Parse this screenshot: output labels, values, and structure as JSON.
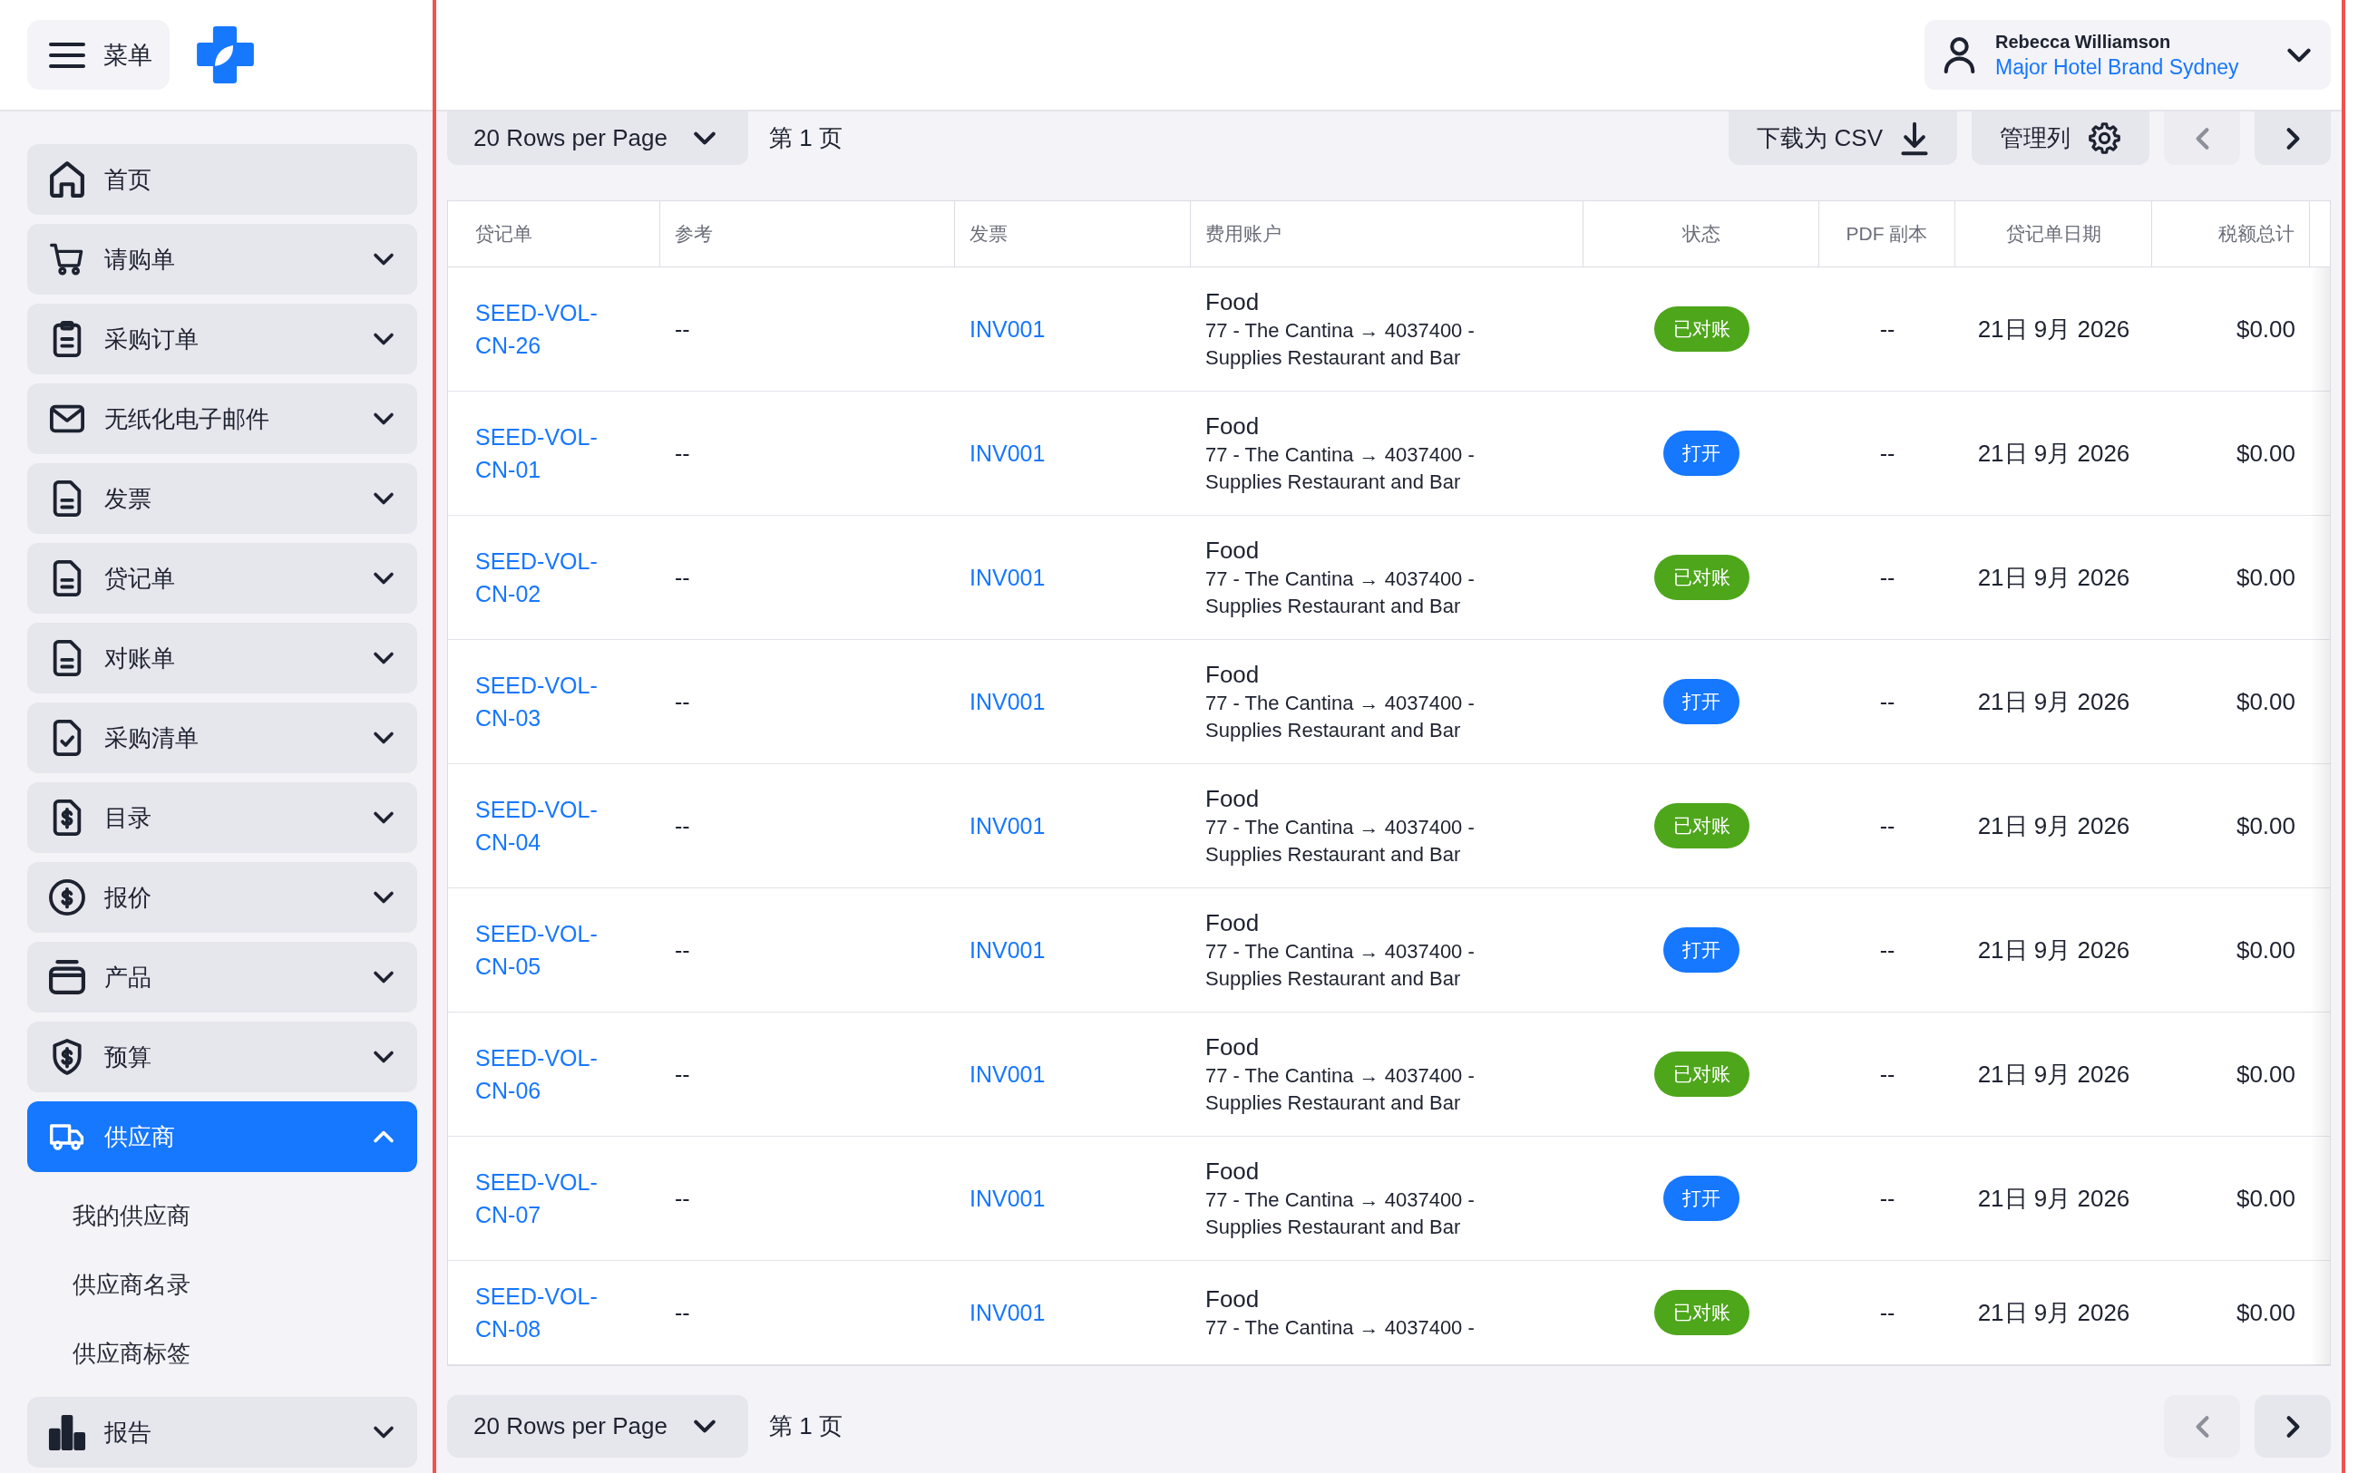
{
  "sidebar": {
    "menu_button": "菜单",
    "items": [
      {
        "label": "首页",
        "kind": "link",
        "selected": false,
        "expanded": false
      },
      {
        "label": "请购单",
        "kind": "group",
        "selected": false,
        "expanded": false
      },
      {
        "label": "采购订单",
        "kind": "group",
        "selected": false,
        "expanded": false
      },
      {
        "label": "无纸化电子邮件",
        "kind": "group",
        "selected": false,
        "expanded": false
      },
      {
        "label": "发票",
        "kind": "group",
        "selected": false,
        "expanded": false
      },
      {
        "label": "贷记单",
        "kind": "group",
        "selected": false,
        "expanded": false
      },
      {
        "label": "对账单",
        "kind": "group",
        "selected": false,
        "expanded": false
      },
      {
        "label": "采购清单",
        "kind": "group",
        "selected": false,
        "expanded": false
      },
      {
        "label": "目录",
        "kind": "group",
        "selected": false,
        "expanded": false
      },
      {
        "label": "报价",
        "kind": "group",
        "selected": false,
        "expanded": false
      },
      {
        "label": "产品",
        "kind": "group",
        "selected": false,
        "expanded": false
      },
      {
        "label": "预算",
        "kind": "group",
        "selected": false,
        "expanded": false
      },
      {
        "label": "供应商",
        "kind": "group",
        "selected": true,
        "expanded": true,
        "children": [
          {
            "label": "我的供应商",
            "selected": false
          },
          {
            "label": "供应商名录",
            "selected": false
          },
          {
            "label": "供应商标签",
            "selected": false
          }
        ]
      },
      {
        "label": "报告",
        "kind": "group",
        "selected": false,
        "expanded": false
      }
    ]
  },
  "user_menu": {
    "name": "Rebecca Williamson",
    "organization": "Major Hotel Brand Sydney"
  },
  "toolbar": {
    "rows_per_page": "20 Rows per Page",
    "page": "第 1 页",
    "download_button": "下载为 CSV",
    "columns_button": "管理列",
    "previous": {
      "disabled": true
    },
    "next": {
      "disabled": false
    }
  },
  "table": {
    "columns": [
      "贷记单",
      "参考",
      "发票",
      "费用账户",
      "状态",
      "PDF 副本",
      "贷记单日期",
      "税额总计"
    ],
    "rows": [
      {
        "credit_note": "SEED-VOL-CN-26",
        "reference": "--",
        "invoice": "INV001",
        "account": {
          "name": "Food",
          "path": "77 - The Cantina → 4037400 - Supplies Restaurant and Bar"
        },
        "status": {
          "label": "已对账",
          "color": "#4ea61b"
        },
        "pdf_copy": "--",
        "date": "21日 9月 2026",
        "tax_total": "$0.00"
      },
      {
        "credit_note": "SEED-VOL-CN-01",
        "reference": "--",
        "invoice": "INV001",
        "account": {
          "name": "Food",
          "path": "77 - The Cantina → 4037400 - Supplies Restaurant and Bar"
        },
        "status": {
          "label": "打开",
          "color": "#1677ff"
        },
        "pdf_copy": "--",
        "date": "21日 9月 2026",
        "tax_total": "$0.00"
      },
      {
        "credit_note": "SEED-VOL-CN-02",
        "reference": "--",
        "invoice": "INV001",
        "account": {
          "name": "Food",
          "path": "77 - The Cantina → 4037400 - Supplies Restaurant and Bar"
        },
        "status": {
          "label": "已对账",
          "color": "#4ea61b"
        },
        "pdf_copy": "--",
        "date": "21日 9月 2026",
        "tax_total": "$0.00"
      },
      {
        "credit_note": "SEED-VOL-CN-03",
        "reference": "--",
        "invoice": "INV001",
        "account": {
          "name": "Food",
          "path": "77 - The Cantina → 4037400 - Supplies Restaurant and Bar"
        },
        "status": {
          "label": "打开",
          "color": "#1677ff"
        },
        "pdf_copy": "--",
        "date": "21日 9月 2026",
        "tax_total": "$0.00"
      },
      {
        "credit_note": "SEED-VOL-CN-04",
        "reference": "--",
        "invoice": "INV001",
        "account": {
          "name": "Food",
          "path": "77 - The Cantina → 4037400 - Supplies Restaurant and Bar"
        },
        "status": {
          "label": "已对账",
          "color": "#4ea61b"
        },
        "pdf_copy": "--",
        "date": "21日 9月 2026",
        "tax_total": "$0.00"
      },
      {
        "credit_note": "SEED-VOL-CN-05",
        "reference": "--",
        "invoice": "INV001",
        "account": {
          "name": "Food",
          "path": "77 - The Cantina → 4037400 - Supplies Restaurant and Bar"
        },
        "status": {
          "label": "打开",
          "color": "#1677ff"
        },
        "pdf_copy": "--",
        "date": "21日 9月 2026",
        "tax_total": "$0.00"
      },
      {
        "credit_note": "SEED-VOL-CN-06",
        "reference": "--",
        "invoice": "INV001",
        "account": {
          "name": "Food",
          "path": "77 - The Cantina → 4037400 - Supplies Restaurant and Bar"
        },
        "status": {
          "label": "已对账",
          "color": "#4ea61b"
        },
        "pdf_copy": "--",
        "date": "21日 9月 2026",
        "tax_total": "$0.00"
      },
      {
        "credit_note": "SEED-VOL-CN-07",
        "reference": "--",
        "invoice": "INV001",
        "account": {
          "name": "Food",
          "path": "77 - The Cantina → 4037400 - Supplies Restaurant and Bar"
        },
        "status": {
          "label": "打开",
          "color": "#1677ff"
        },
        "pdf_copy": "--",
        "date": "21日 9月 2026",
        "tax_total": "$0.00"
      },
      {
        "credit_note": "SEED-VOL-CN-08",
        "reference": "--",
        "invoice": "INV001",
        "account": {
          "name": "Food",
          "path": "77 - The Cantina → 4037400 -"
        },
        "status": {
          "label": "已对账",
          "color": "#4ea61b"
        },
        "pdf_copy": "--",
        "date": "21日 9月 2026",
        "tax_total": "$0.00"
      }
    ]
  },
  "footer": {
    "rows_per_page": "20 Rows per Page",
    "page": "第 1 页",
    "previous": {
      "disabled": true
    },
    "next": {
      "disabled": false
    }
  }
}
